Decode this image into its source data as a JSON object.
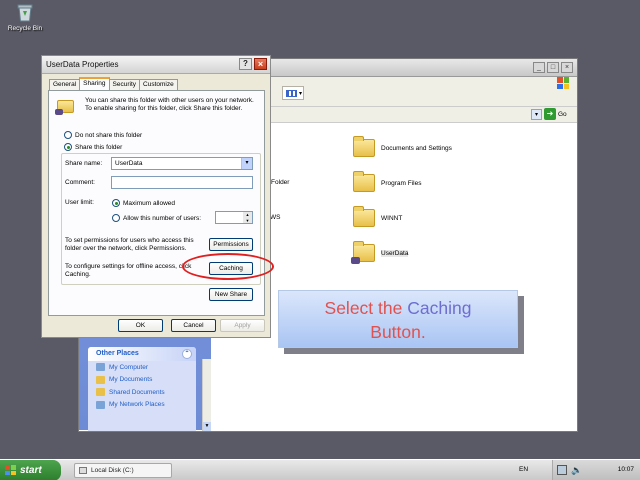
{
  "desktop": {
    "recycle_bin_label": "Recycle Bin"
  },
  "explorer": {
    "address_go": "Go",
    "folders": [
      "Documents and Settings",
      "Program Files",
      "WINNT",
      "UserData"
    ],
    "fragments": [
      "ed Folder",
      "WS"
    ],
    "other_places": {
      "title": "Other Places",
      "items": [
        "My Computer",
        "My Documents",
        "Shared Documents",
        "My Network Places"
      ]
    }
  },
  "dialog": {
    "title": "UserData Properties",
    "tabs": [
      "General",
      "Sharing",
      "Security",
      "Customize"
    ],
    "intro": "You can share this folder with other users on your network.  To enable sharing for this folder, click Share this folder.",
    "radio_not_share": "Do not share this folder",
    "radio_share": "Share this folder",
    "share_name_label": "Share name:",
    "share_name_value": "UserData",
    "comment_label": "Comment:",
    "comment_value": "",
    "user_limit_label": "User limit:",
    "max_allowed": "Maximum allowed",
    "allow_number": "Allow this number of users:",
    "permissions_text": "To set permissions for users who access this folder over the network, click Permissions.",
    "permissions_button": "Permissions",
    "caching_text": "To configure settings for offline access, click Caching.",
    "caching_button": "Caching",
    "new_share_button": "New Share",
    "ok_button": "OK",
    "cancel_button": "Cancel",
    "apply_button": "Apply"
  },
  "callout": {
    "part1": "Select the ",
    "highlight": "Caching",
    "part2": "Button."
  },
  "taskbar": {
    "start_label": "start",
    "task_item": "Local Disk (C:)",
    "language": "EN",
    "clock": "10:07"
  },
  "colors": {
    "accent_red": "#e02020",
    "callout_text": "#e0524f",
    "callout_highlight": "#6e6ed0"
  }
}
